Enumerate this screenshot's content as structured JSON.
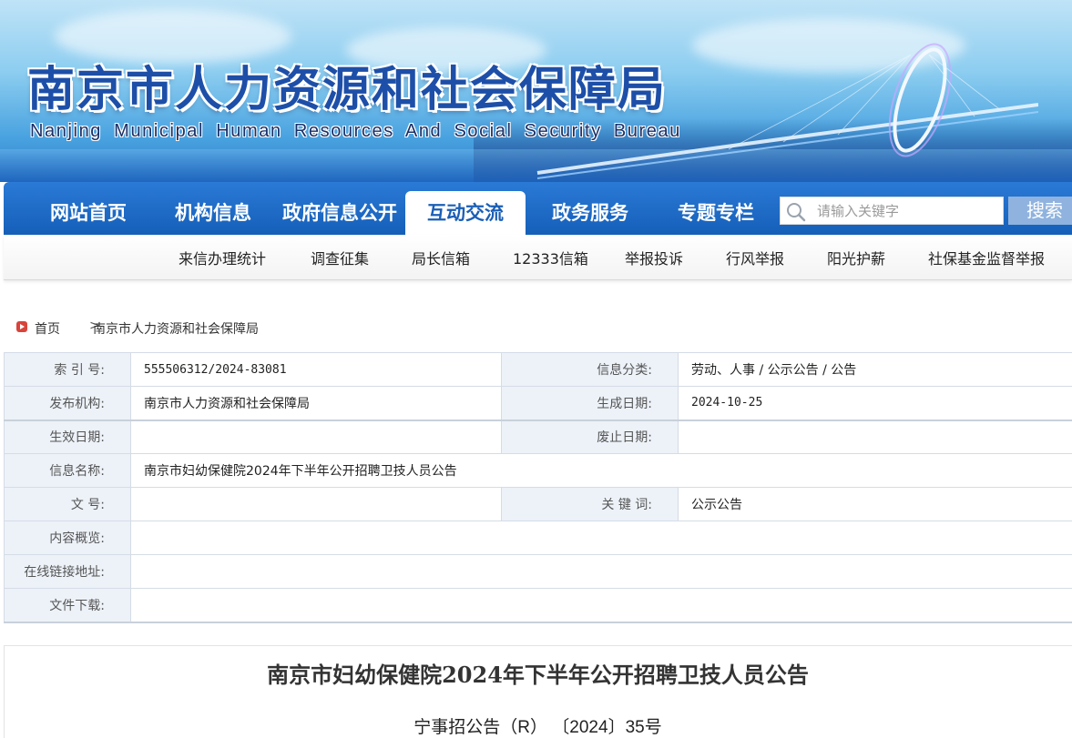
{
  "header": {
    "title_cn": "南京市人力资源和社会保障局",
    "title_en": "Nanjing Municipal Human Resources And Social Security Bureau"
  },
  "main_nav": {
    "items": [
      {
        "label": "网站首页",
        "active": false
      },
      {
        "label": "机构信息",
        "active": false
      },
      {
        "label": "政府信息公开",
        "active": false
      },
      {
        "label": "互动交流",
        "active": true
      },
      {
        "label": "政务服务",
        "active": false
      },
      {
        "label": "专题专栏",
        "active": false
      }
    ],
    "active_text_color": "#1b5fb6",
    "bar_color": "#1d6ac6"
  },
  "search": {
    "placeholder": "请输入关键字",
    "button_label": "搜索",
    "icon": "search-icon"
  },
  "sub_nav": {
    "items": [
      "来信办理统计",
      "调查征集",
      "局长信箱",
      "12333信箱",
      "举报投诉",
      "行风举报",
      "阳光护薪",
      "社保基金监督举报"
    ]
  },
  "breadcrumb": {
    "home": "首页",
    "separator": ">",
    "current": "南京市人力资源和社会保障局",
    "icon": "home-icon"
  },
  "info_table": {
    "index_label": "索 引 号:",
    "index_value": "555506312/2024-83081",
    "category_label": "信息分类:",
    "category_value": "劳动、人事 / 公示公告 / 公告",
    "publisher_label": "发布机构:",
    "publisher_value": "南京市人力资源和社会保障局",
    "created_label": "生成日期:",
    "created_value": "2024-10-25",
    "effective_label": "生效日期:",
    "effective_value": "",
    "expired_label": "废止日期:",
    "expired_value": "",
    "name_label": "信息名称:",
    "name_value": "南京市妇幼保健院2024年下半年公开招聘卫技人员公告",
    "docno_label": "文 号:",
    "docno_value": "",
    "keywords_label": "关 键 词:",
    "keywords_value": "公示公告",
    "summary_label": "内容概览:",
    "summary_value": "",
    "link_label": "在线链接地址:",
    "link_value": "",
    "download_label": "文件下载:",
    "download_value": ""
  },
  "article": {
    "title": "南京市妇幼保健院2024年下半年公开招聘卫技人员公告",
    "doc_number": "宁事招公告（R） 〔2024〕35号"
  }
}
